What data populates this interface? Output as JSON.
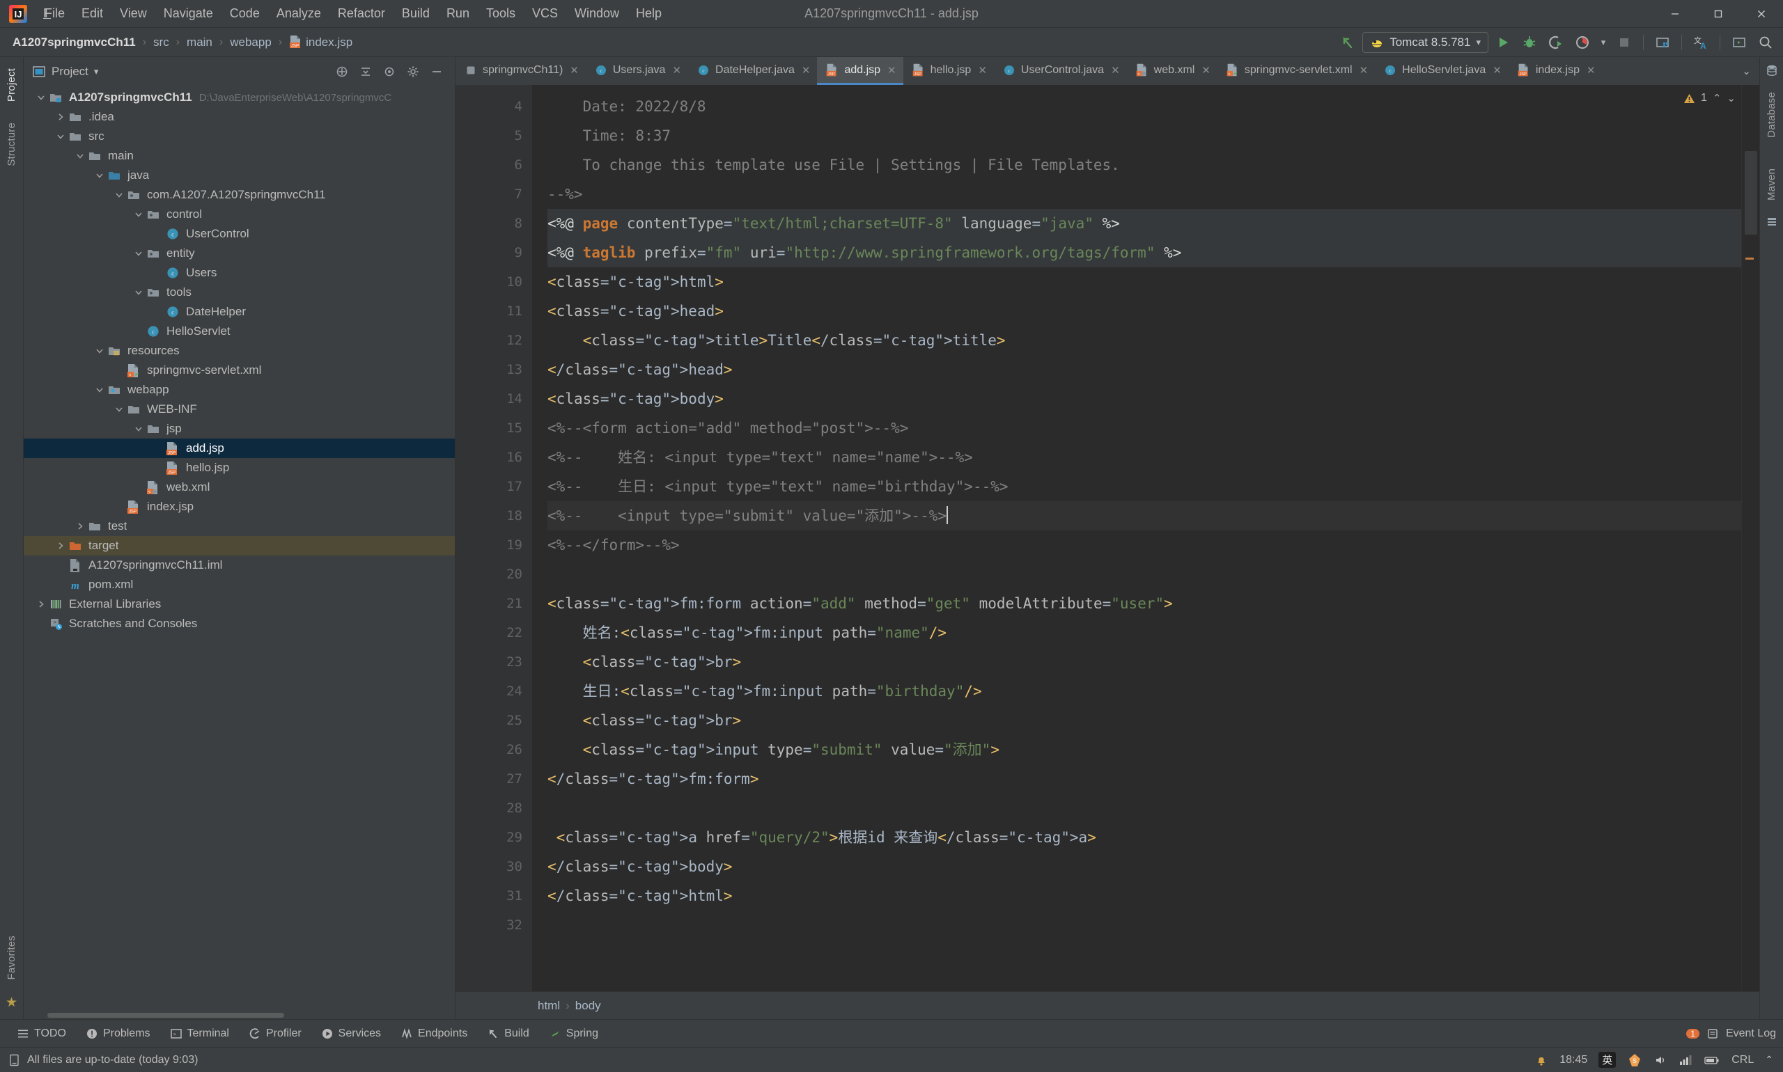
{
  "window": {
    "title": "A1207springmvcCh11 - add.jsp",
    "controls": {
      "minimize": "—",
      "maximize": "☐",
      "close": "✕"
    }
  },
  "menubar": {
    "items": [
      {
        "label": "File",
        "mnemonic": "F"
      },
      {
        "label": "Edit",
        "mnemonic": "E"
      },
      {
        "label": "View",
        "mnemonic": "V"
      },
      {
        "label": "Navigate",
        "mnemonic": "N"
      },
      {
        "label": "Code",
        "mnemonic": "C"
      },
      {
        "label": "Analyze",
        "mnemonic": ""
      },
      {
        "label": "Refactor",
        "mnemonic": "R"
      },
      {
        "label": "Build",
        "mnemonic": "B"
      },
      {
        "label": "Run",
        "mnemonic": "u"
      },
      {
        "label": "Tools",
        "mnemonic": "T"
      },
      {
        "label": "VCS",
        "mnemonic": ""
      },
      {
        "label": "Window",
        "mnemonic": "W"
      },
      {
        "label": "Help",
        "mnemonic": "H"
      }
    ]
  },
  "navbar": {
    "breadcrumbs": [
      "A1207springmvcCh11",
      "src",
      "main",
      "webapp",
      "index.jsp"
    ],
    "separator": "›",
    "run_configuration": {
      "name": "Tomcat 8.5.781",
      "icon": "tomcat-icon",
      "dropdown": "▾"
    },
    "actions": [
      "back-arrow-icon",
      "run-icon",
      "debug-icon",
      "run-coverage-icon",
      "profiler-icon",
      "stop-icon",
      "project-structure-icon",
      "translate-icon",
      "terminal-icon",
      "search-everywhere-icon"
    ]
  },
  "leftstrip": {
    "tabs": [
      "Project",
      "Structure"
    ],
    "bottom_tabs": [
      "Favorites"
    ]
  },
  "rightstrip": {
    "tabs": [
      "Database",
      "Maven"
    ]
  },
  "project_panel": {
    "title": "Project",
    "dropdown": "▾",
    "header_icons": [
      "expand-all-icon",
      "collapse-all-icon",
      "select-opened-file-icon",
      "settings-icon",
      "hide-icon"
    ],
    "tree": [
      {
        "label": "A1207springmvcCh11",
        "path": "D:\\JavaEnterpriseWeb\\A1207springmvcC",
        "depth": 0,
        "arrow": "down",
        "icon": "module-folder-icon",
        "bold": true,
        "state": "normal"
      },
      {
        "label": ".idea",
        "path": "",
        "depth": 1,
        "arrow": "right",
        "icon": "folder-icon",
        "bold": false,
        "state": "normal"
      },
      {
        "label": "src",
        "path": "",
        "depth": 1,
        "arrow": "down",
        "icon": "folder-icon",
        "bold": false,
        "state": "normal"
      },
      {
        "label": "main",
        "path": "",
        "depth": 2,
        "arrow": "down",
        "icon": "folder-icon",
        "bold": false,
        "state": "normal"
      },
      {
        "label": "java",
        "path": "",
        "depth": 3,
        "arrow": "down",
        "icon": "source-folder-icon",
        "bold": false,
        "state": "normal"
      },
      {
        "label": "com.A1207.A1207springmvcCh11",
        "path": "",
        "depth": 4,
        "arrow": "down",
        "icon": "package-icon",
        "bold": false,
        "state": "normal"
      },
      {
        "label": "control",
        "path": "",
        "depth": 5,
        "arrow": "down",
        "icon": "package-icon",
        "bold": false,
        "state": "normal"
      },
      {
        "label": "UserControl",
        "path": "",
        "depth": 6,
        "arrow": "none",
        "icon": "java-class-icon",
        "bold": false,
        "state": "normal"
      },
      {
        "label": "entity",
        "path": "",
        "depth": 5,
        "arrow": "down",
        "icon": "package-icon",
        "bold": false,
        "state": "normal"
      },
      {
        "label": "Users",
        "path": "",
        "depth": 6,
        "arrow": "none",
        "icon": "java-class-icon",
        "bold": false,
        "state": "normal"
      },
      {
        "label": "tools",
        "path": "",
        "depth": 5,
        "arrow": "down",
        "icon": "package-icon",
        "bold": false,
        "state": "normal"
      },
      {
        "label": "DateHelper",
        "path": "",
        "depth": 6,
        "arrow": "none",
        "icon": "java-class-icon",
        "bold": false,
        "state": "normal"
      },
      {
        "label": "HelloServlet",
        "path": "",
        "depth": 5,
        "arrow": "none",
        "icon": "java-class-icon",
        "bold": false,
        "state": "normal"
      },
      {
        "label": "resources",
        "path": "",
        "depth": 3,
        "arrow": "down",
        "icon": "resources-folder-icon",
        "bold": false,
        "state": "normal"
      },
      {
        "label": "springmvc-servlet.xml",
        "path": "",
        "depth": 4,
        "arrow": "none",
        "icon": "spring-xml-icon",
        "bold": false,
        "state": "normal"
      },
      {
        "label": "webapp",
        "path": "",
        "depth": 3,
        "arrow": "down",
        "icon": "webapp-folder-icon",
        "bold": false,
        "state": "normal"
      },
      {
        "label": "WEB-INF",
        "path": "",
        "depth": 4,
        "arrow": "down",
        "icon": "folder-icon",
        "bold": false,
        "state": "normal"
      },
      {
        "label": "jsp",
        "path": "",
        "depth": 5,
        "arrow": "down",
        "icon": "folder-icon",
        "bold": false,
        "state": "normal"
      },
      {
        "label": "add.jsp",
        "path": "",
        "depth": 6,
        "arrow": "none",
        "icon": "jsp-file-icon",
        "bold": false,
        "state": "selected"
      },
      {
        "label": "hello.jsp",
        "path": "",
        "depth": 6,
        "arrow": "none",
        "icon": "jsp-file-icon",
        "bold": false,
        "state": "normal"
      },
      {
        "label": "web.xml",
        "path": "",
        "depth": 5,
        "arrow": "none",
        "icon": "web-xml-icon",
        "bold": false,
        "state": "normal"
      },
      {
        "label": "index.jsp",
        "path": "",
        "depth": 4,
        "arrow": "none",
        "icon": "jsp-file-icon",
        "bold": false,
        "state": "normal"
      },
      {
        "label": "test",
        "path": "",
        "depth": 2,
        "arrow": "right",
        "icon": "folder-icon",
        "bold": false,
        "state": "normal"
      },
      {
        "label": "target",
        "path": "",
        "depth": 1,
        "arrow": "right",
        "icon": "target-folder-icon",
        "bold": false,
        "state": "highlight"
      },
      {
        "label": "A1207springmvcCh11.iml",
        "path": "",
        "depth": 1,
        "arrow": "none",
        "icon": "iml-file-icon",
        "bold": false,
        "state": "normal"
      },
      {
        "label": "pom.xml",
        "path": "",
        "depth": 1,
        "arrow": "none",
        "icon": "maven-pom-icon",
        "bold": false,
        "state": "normal"
      },
      {
        "label": "External Libraries",
        "path": "",
        "depth": 0,
        "arrow": "right",
        "icon": "libraries-icon",
        "bold": false,
        "state": "normal"
      },
      {
        "label": "Scratches and Consoles",
        "path": "",
        "depth": 0,
        "arrow": "none",
        "icon": "scratches-icon",
        "bold": false,
        "state": "normal"
      }
    ]
  },
  "editor_tabs": {
    "tabs": [
      {
        "label": "springmvcCh11)",
        "icon": "generic-icon",
        "active": false
      },
      {
        "label": "Users.java",
        "icon": "java-class-icon",
        "active": false
      },
      {
        "label": "DateHelper.java",
        "icon": "java-class-icon",
        "active": false
      },
      {
        "label": "add.jsp",
        "icon": "jsp-file-icon",
        "active": true
      },
      {
        "label": "hello.jsp",
        "icon": "jsp-file-icon",
        "active": false
      },
      {
        "label": "UserControl.java",
        "icon": "java-class-icon",
        "active": false
      },
      {
        "label": "web.xml",
        "icon": "web-xml-icon",
        "active": false
      },
      {
        "label": "springmvc-servlet.xml",
        "icon": "spring-xml-icon",
        "active": false
      },
      {
        "label": "HelloServlet.java",
        "icon": "java-class-icon",
        "active": false
      },
      {
        "label": "index.jsp",
        "icon": "jsp-file-icon",
        "active": false
      }
    ],
    "close_glyph": "✕",
    "overflow_glyph": "⌄"
  },
  "editor": {
    "filename": "add.jsp",
    "first_line_number": 4,
    "cursor_line": 18,
    "inspection": {
      "warnings": "1",
      "icon": "warning-triangle-icon"
    },
    "lines": [
      {
        "n": 4,
        "fold": "",
        "text": "    Date: 2022/8/8"
      },
      {
        "n": 5,
        "fold": "",
        "text": "    Time: 8:37"
      },
      {
        "n": 6,
        "fold": "",
        "text": "    To change this template use File | Settings | File Templates."
      },
      {
        "n": 7,
        "fold": "end",
        "text": "--%>"
      },
      {
        "n": 8,
        "fold": "",
        "text": "<%@ page contentType=\"text/html;charset=UTF-8\" language=\"java\" %>"
      },
      {
        "n": 9,
        "fold": "",
        "text": "<%@ taglib prefix=\"fm\" uri=\"http://www.springframework.org/tags/form\" %>"
      },
      {
        "n": 10,
        "fold": "start",
        "text": "<html>"
      },
      {
        "n": 11,
        "fold": "start",
        "text": "<head>"
      },
      {
        "n": 12,
        "fold": "",
        "text": "    <title>Title</title>"
      },
      {
        "n": 13,
        "fold": "end",
        "text": "</head>"
      },
      {
        "n": 14,
        "fold": "start",
        "text": "<body>"
      },
      {
        "n": 15,
        "fold": "",
        "text": "<%--<form action=\"add\" method=\"post\">--%>"
      },
      {
        "n": 16,
        "fold": "",
        "text": "<%--    姓名: <input type=\"text\" name=\"name\">--%>"
      },
      {
        "n": 17,
        "fold": "",
        "text": "<%--    生日: <input type=\"text\" name=\"birthday\">--%>"
      },
      {
        "n": 18,
        "fold": "",
        "text": "<%--    <input type=\"submit\" value=\"添加\">--%>"
      },
      {
        "n": 19,
        "fold": "",
        "text": "<%--</form>--%>"
      },
      {
        "n": 20,
        "fold": "",
        "text": ""
      },
      {
        "n": 21,
        "fold": "start",
        "text": "<fm:form action=\"add\" method=\"get\" modelAttribute=\"user\">"
      },
      {
        "n": 22,
        "fold": "",
        "text": "    姓名:<fm:input path=\"name\"/>"
      },
      {
        "n": 23,
        "fold": "",
        "text": "    <br>"
      },
      {
        "n": 24,
        "fold": "",
        "text": "    生日:<fm:input path=\"birthday\"/>"
      },
      {
        "n": 25,
        "fold": "",
        "text": "    <br>"
      },
      {
        "n": 26,
        "fold": "",
        "text": "    <input type=\"submit\" value=\"添加\">"
      },
      {
        "n": 27,
        "fold": "end",
        "text": "</fm:form>"
      },
      {
        "n": 28,
        "fold": "",
        "text": ""
      },
      {
        "n": 29,
        "fold": "",
        "text": " <a href=\"query/2\">根据id 来查询</a>"
      },
      {
        "n": 30,
        "fold": "end",
        "text": "</body>"
      },
      {
        "n": 31,
        "fold": "end",
        "text": "</html>"
      },
      {
        "n": 32,
        "fold": "",
        "text": ""
      }
    ]
  },
  "editor_breadcrumb": {
    "items": [
      "html",
      "body"
    ],
    "separator": "›"
  },
  "bottom_toolbar": {
    "items": [
      {
        "label": "TODO",
        "icon": "todo-icon"
      },
      {
        "label": "Problems",
        "icon": "problems-icon"
      },
      {
        "label": "Terminal",
        "icon": "terminal-icon"
      },
      {
        "label": "Profiler",
        "icon": "profiler-icon"
      },
      {
        "label": "Services",
        "icon": "services-icon"
      },
      {
        "label": "Endpoints",
        "icon": "endpoints-icon"
      },
      {
        "label": "Build",
        "icon": "build-icon"
      },
      {
        "label": "Spring",
        "icon": "spring-icon"
      }
    ],
    "event_log": {
      "label": "Event Log",
      "icon": "event-log-icon",
      "badge": "1"
    }
  },
  "statusbar": {
    "message": "All files are up-to-date (today 9:03)",
    "message_icon": "file-sync-icon",
    "time": "18:45",
    "line_separator": "CRL",
    "tray": [
      "notification-icon",
      "ime-chinese-icon",
      "speaker-icon",
      "network-icon",
      "battery-icon",
      "chevron-up-icon"
    ],
    "ime_label": "英"
  },
  "colors": {
    "background": "#3c3f41",
    "editor_background": "#2b2b2b",
    "gutter_background": "#313335",
    "selection": "#0d293e",
    "tab_active": "#4e5254",
    "accent_blue": "#4a88c7",
    "accent_orange": "#cc7832",
    "string_green": "#6a8759",
    "tag_yellow": "#e8bf6a",
    "comment_gray": "#808080",
    "target_highlight": "#4e4a36"
  }
}
